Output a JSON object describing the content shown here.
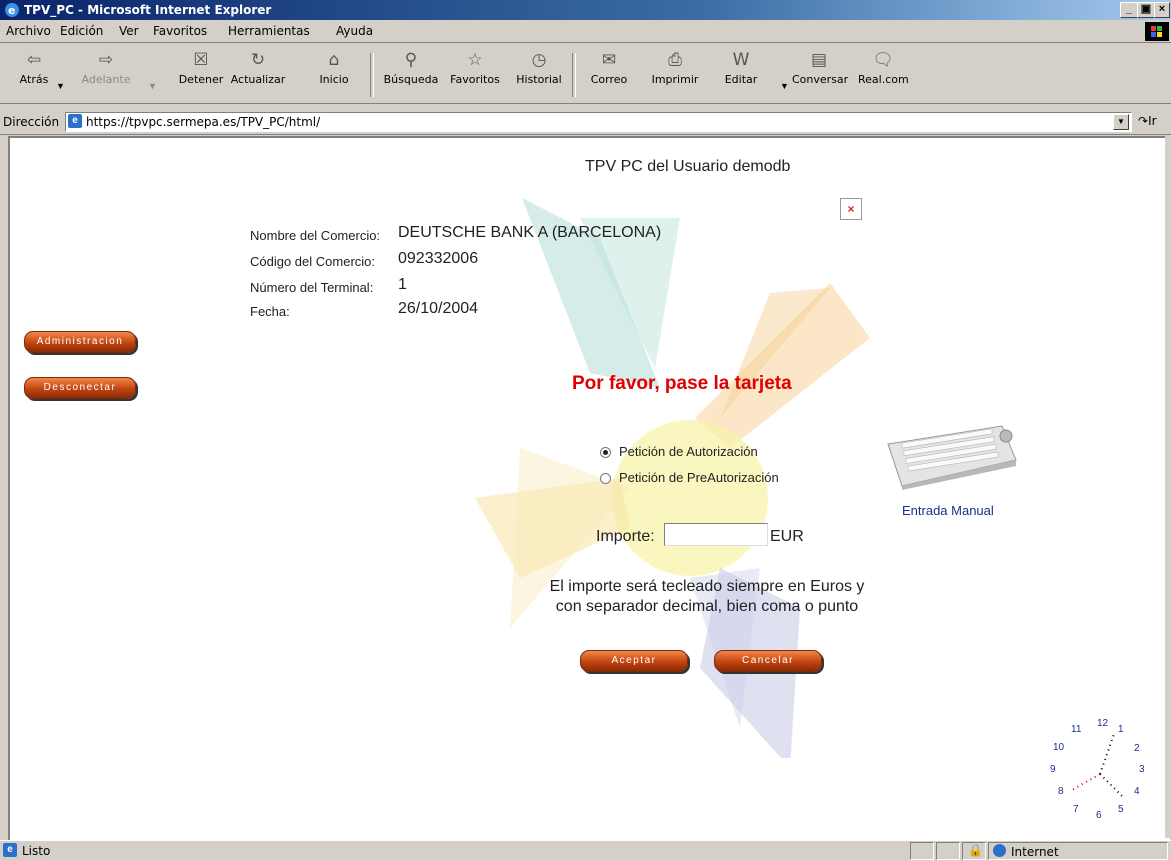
{
  "window": {
    "title": "TPV_PC - Microsoft Internet Explorer",
    "min_label": "_",
    "max_label": "̣❒",
    "close_label": "✕"
  },
  "menu": [
    "Archivo",
    "Edición",
    "Ver",
    "Favoritos",
    "Herramientas",
    "Ayuda"
  ],
  "toolbar": {
    "back": "Atrás",
    "forward": "Adelante",
    "stop": "Detener",
    "refresh": "Actualizar",
    "home": "Inicio",
    "search": "Búsqueda",
    "favorites": "Favoritos",
    "history": "Historial",
    "mail": "Correo",
    "print": "Imprimir",
    "edit": "Editar",
    "discuss": "Conversar",
    "realcom": "Real.com"
  },
  "address": {
    "label": "Dirección",
    "url": "https://tpvpc.sermepa.es/TPV_PC/html/",
    "go": "Ir"
  },
  "page": {
    "heading": "TPV PC del Usuario demodb",
    "info": {
      "merchant_name_label": "Nombre del Comercio:",
      "merchant_name": "DEUTSCHE BANK A (BARCELONA)",
      "merchant_code_label": "Código del Comercio:",
      "merchant_code": "092332006",
      "terminal_label": "Número del Terminal:",
      "terminal": "1",
      "date_label": "Fecha:",
      "date": "26/10/2004"
    },
    "admin_button": "Administracion",
    "disconnect_button": "Desconectar",
    "swipe_prompt": "Por favor, pase la tarjeta",
    "options": [
      "Petición de Autorización",
      "Petición de PreAutorización"
    ],
    "manual_entry": "Entrada Manual",
    "amount_label": "Importe:",
    "amount_value": "",
    "currency": "EUR",
    "note_line1": "El importe será tecleado siempre en Euros y",
    "note_line2": "con separador decimal, bien coma o punto",
    "accept_button": "Aceptar",
    "cancel_button": "Cancelar"
  },
  "clock_numbers": [
    "12",
    "1",
    "2",
    "3",
    "4",
    "5",
    "6",
    "7",
    "8",
    "9",
    "10",
    "11"
  ],
  "status": {
    "text": "Listo",
    "zone": "Internet"
  }
}
